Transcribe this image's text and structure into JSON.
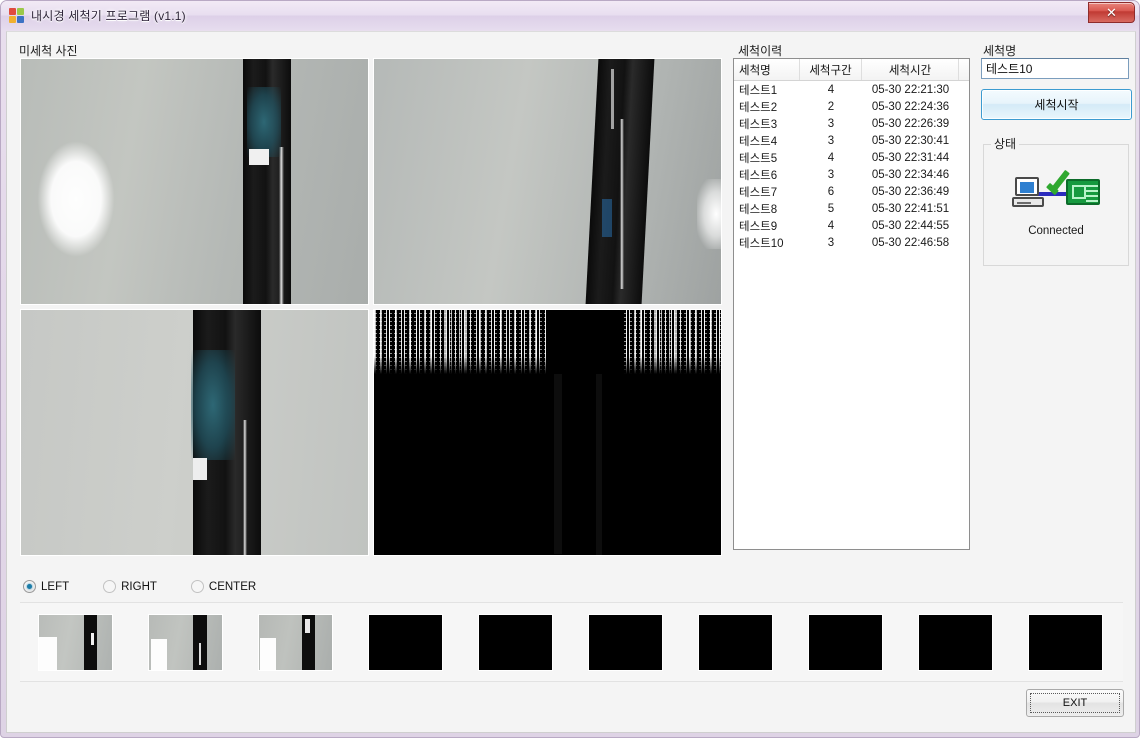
{
  "window": {
    "title": "내시경 세척기 프로그램 (v1.1)",
    "app_icon": "windows-logo-icon",
    "close_label": "✕",
    "frame_color": "#e3d8e9"
  },
  "photos": {
    "group_label": "미세척 사진",
    "panels": [
      {
        "name": "photo-top-left",
        "kind": "endoscope-photo",
        "desc": "tube-with-residue"
      },
      {
        "name": "photo-top-right",
        "kind": "endoscope-photo",
        "desc": "tube-with-highlight"
      },
      {
        "name": "photo-bottom-left",
        "kind": "endoscope-photo",
        "desc": "tube-closeup-residue"
      },
      {
        "name": "photo-bottom-right",
        "kind": "threshold-binary",
        "desc": "black-with-noise-band"
      }
    ]
  },
  "side_selector": {
    "options": [
      {
        "label": "LEFT",
        "selected": true
      },
      {
        "label": "RIGHT",
        "selected": false
      },
      {
        "label": "CENTER",
        "selected": false
      }
    ]
  },
  "thumbnails": {
    "count": 10,
    "items": [
      {
        "index": 1,
        "kind": "photo"
      },
      {
        "index": 2,
        "kind": "photo"
      },
      {
        "index": 3,
        "kind": "photo"
      },
      {
        "index": 4,
        "kind": "black"
      },
      {
        "index": 5,
        "kind": "black"
      },
      {
        "index": 6,
        "kind": "black"
      },
      {
        "index": 7,
        "kind": "black"
      },
      {
        "index": 8,
        "kind": "black"
      },
      {
        "index": 9,
        "kind": "black"
      },
      {
        "index": 10,
        "kind": "black"
      }
    ]
  },
  "history": {
    "group_label": "세척이력",
    "columns": [
      "세척명",
      "세척구간",
      "세척시간",
      ""
    ],
    "rows": [
      {
        "name": "테스트1",
        "section": "4",
        "time": "05-30 22:21:30"
      },
      {
        "name": "테스트2",
        "section": "2",
        "time": "05-30 22:24:36"
      },
      {
        "name": "테스트3",
        "section": "3",
        "time": "05-30 22:26:39"
      },
      {
        "name": "테스트4",
        "section": "3",
        "time": "05-30 22:30:41"
      },
      {
        "name": "테스트5",
        "section": "4",
        "time": "05-30 22:31:44"
      },
      {
        "name": "테스트6",
        "section": "3",
        "time": "05-30 22:34:46"
      },
      {
        "name": "테스트7",
        "section": "6",
        "time": "05-30 22:36:49"
      },
      {
        "name": "테스트8",
        "section": "5",
        "time": "05-30 22:41:51"
      },
      {
        "name": "테스트9",
        "section": "4",
        "time": "05-30 22:44:55"
      },
      {
        "name": "테스트10",
        "section": "3",
        "time": "05-30 22:46:58"
      }
    ]
  },
  "right_panel": {
    "name_label": "세척명",
    "name_value": "테스트10",
    "start_button": "세척시작",
    "status_group_label": "상태",
    "status_icon": "network-connected-icon",
    "status_text": "Connected",
    "accent_color": "#3c9bd0"
  },
  "footer": {
    "exit_label": "EXIT"
  }
}
